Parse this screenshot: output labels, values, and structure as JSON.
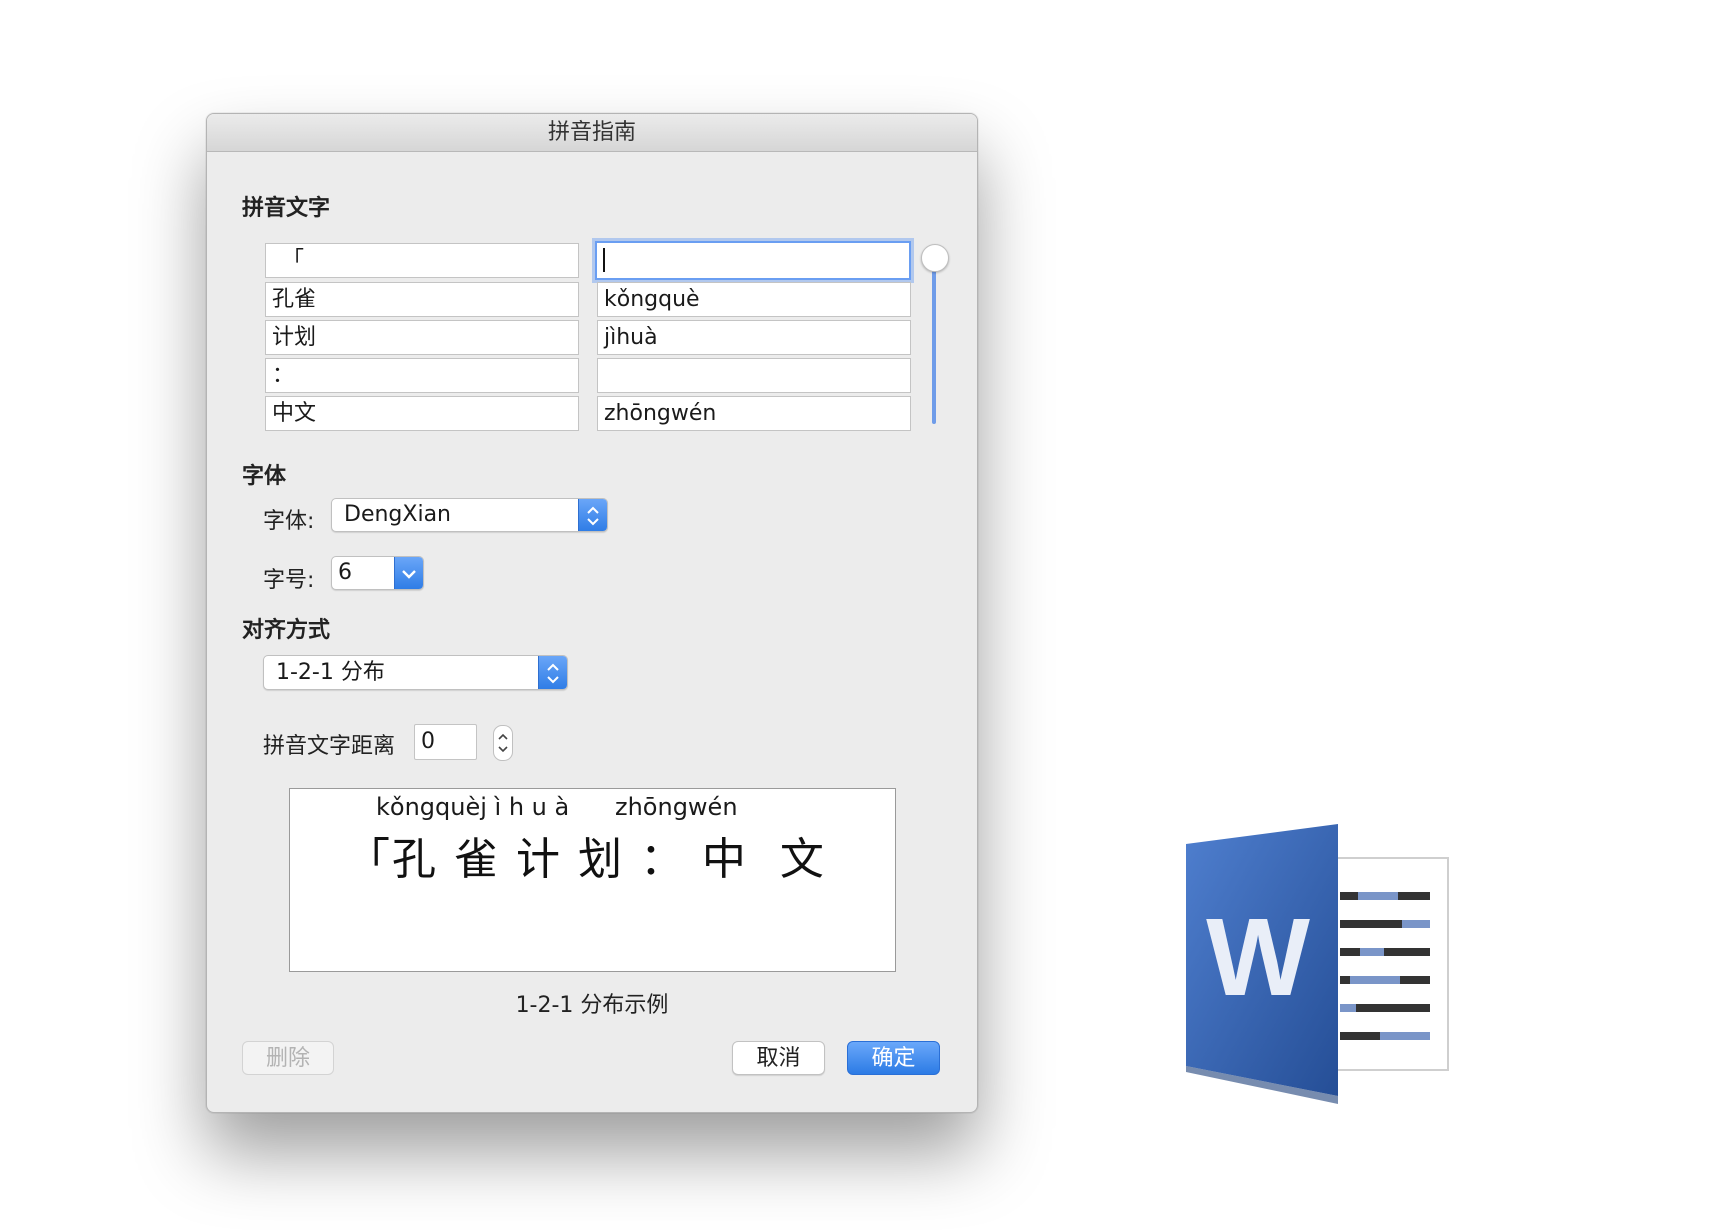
{
  "dialog": {
    "title": "拼音指南",
    "pinyin_section_title": "拼音文字",
    "rows": [
      {
        "base": "「",
        "ruby": ""
      },
      {
        "base": "孔雀",
        "ruby": "kǒngquè"
      },
      {
        "base": "计划",
        "ruby": "jìhuà"
      },
      {
        "base": "：",
        "ruby": ""
      },
      {
        "base": "中文",
        "ruby": "zhōngwén"
      }
    ],
    "font_section_title": "字体",
    "font_label": "字体:",
    "font_value": "DengXian",
    "size_label": "字号:",
    "size_value": "6",
    "align_section_title": "对齐方式",
    "align_value": "1-2-1 分布",
    "offset_label": "拼音文字距离",
    "offset_value": "0",
    "preview": {
      "ruby_line": "kǒngquèj ì h u à      zhōngwén",
      "base_line": "「孔 雀 计 划 ： 中  文"
    },
    "preview_caption": "1-2-1 分布示例",
    "buttons": {
      "delete": "删除",
      "cancel": "取消",
      "ok": "确定"
    }
  },
  "colors": {
    "accent": "#2c7be5",
    "word_blue": "#2b579a"
  },
  "icons": {
    "app": "microsoft-word-icon"
  },
  "word_icon_letter": "W"
}
